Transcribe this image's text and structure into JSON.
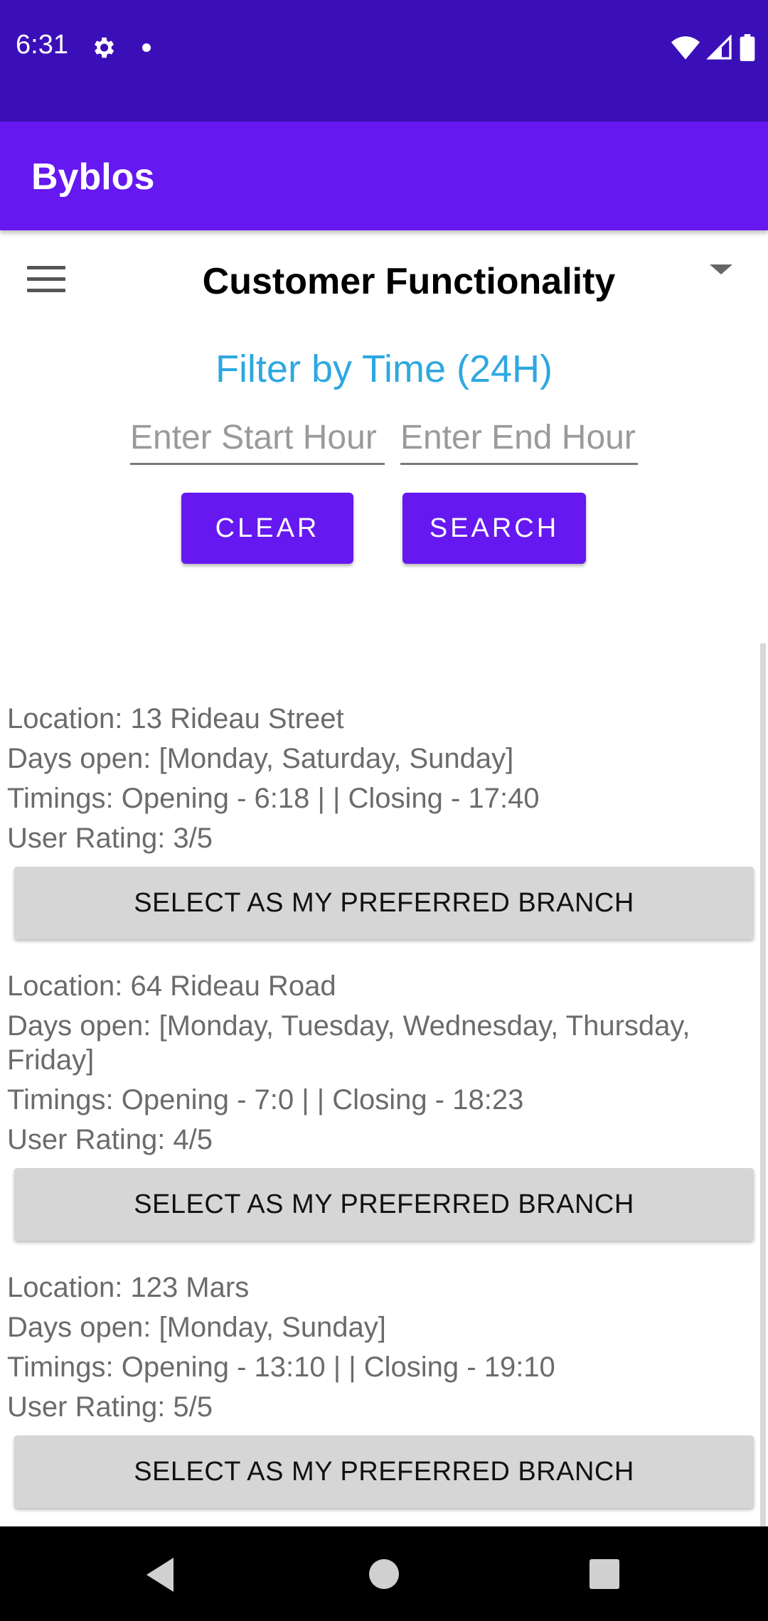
{
  "status_bar": {
    "time": "6:31",
    "icons": [
      "gear-icon",
      "notification-dot-icon",
      "wifi-icon",
      "cell-signal-icon",
      "battery-icon"
    ]
  },
  "app_bar": {
    "title": "Byblos",
    "color": "#6518f0"
  },
  "toolbar": {
    "menu_icon": "hamburger-menu-icon",
    "spinner_selected": "Customer Functionality"
  },
  "filter": {
    "title": "Filter by Time (24H)",
    "start_placeholder": "Enter Start Hour",
    "end_placeholder": "Enter End Hour",
    "clear_label": "CLEAR",
    "search_label": "SEARCH"
  },
  "branches": [
    {
      "location": "Location: 13 Rideau Street",
      "days": "Days open: [Monday, Saturday, Sunday]",
      "timings": "Timings: Opening - 6:18 | | Closing - 17:40",
      "rating": "User Rating: 3/5",
      "button": "SELECT AS MY PREFERRED BRANCH"
    },
    {
      "location": "Location: 64 Rideau Road",
      "days": "Days open: [Monday, Tuesday, Wednesday, Thursday, Friday]",
      "timings": "Timings: Opening - 7:0 | | Closing - 18:23",
      "rating": "User Rating: 4/5",
      "button": "SELECT AS MY PREFERRED BRANCH"
    },
    {
      "location": "Location: 123 Mars",
      "days": "Days open: [Monday, Sunday]",
      "timings": "Timings: Opening - 13:10 | | Closing - 19:10",
      "rating": "User Rating: 5/5",
      "button": "SELECT AS MY PREFERRED BRANCH"
    }
  ],
  "nav_bar": {
    "icons": [
      "back-icon",
      "home-icon",
      "recents-icon"
    ]
  }
}
